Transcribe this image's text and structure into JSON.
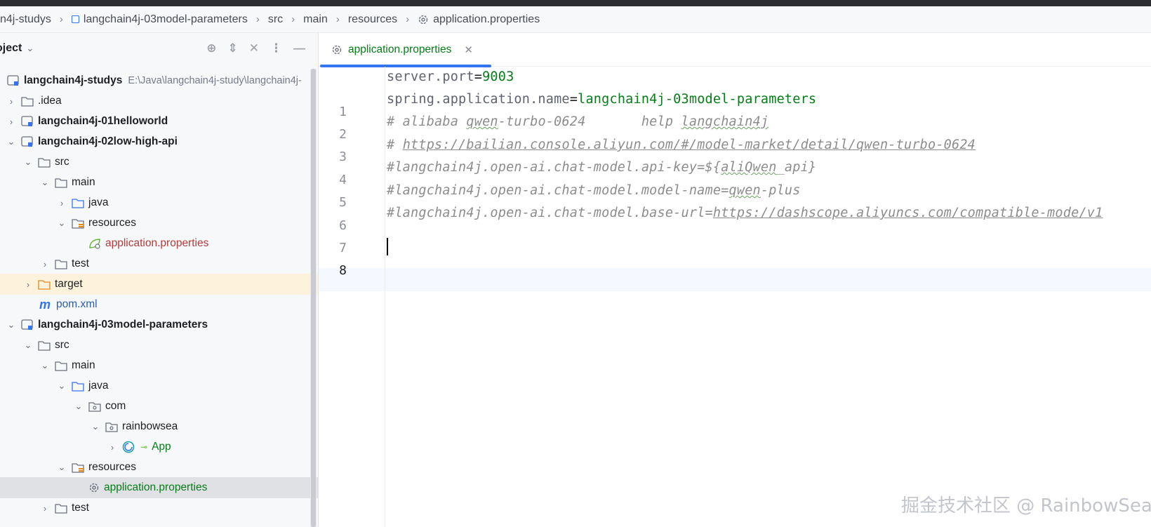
{
  "breadcrumb": {
    "items": [
      "n4j-studys",
      "langchain4j-03model-parameters",
      "src",
      "main",
      "resources",
      "application.properties"
    ]
  },
  "panel": {
    "title": "oject",
    "tree": [
      {
        "label": "langchain4j-studys",
        "hint": "E:\\Java\\langchain4j-study\\langchain4j-"
      },
      {
        "label": ".idea"
      },
      {
        "label": "langchain4j-01helloworld"
      },
      {
        "label": "langchain4j-02low-high-api"
      },
      {
        "label": "src"
      },
      {
        "label": "main"
      },
      {
        "label": "java"
      },
      {
        "label": "resources"
      },
      {
        "label": "application.properties"
      },
      {
        "label": "test"
      },
      {
        "label": "target"
      },
      {
        "label": "pom.xml"
      },
      {
        "label": "langchain4j-03model-parameters"
      },
      {
        "label": "src"
      },
      {
        "label": "main"
      },
      {
        "label": "java"
      },
      {
        "label": "com"
      },
      {
        "label": "rainbowsea"
      },
      {
        "label": "App"
      },
      {
        "label": "resources"
      },
      {
        "label": "application.properties"
      },
      {
        "label": "test"
      }
    ]
  },
  "editor": {
    "tab_label": "application.properties",
    "line_numbers": [
      "1",
      "2",
      "3",
      "4",
      "5",
      "6",
      "7",
      "8"
    ],
    "lines": {
      "l1_key": "server.port",
      "l1_eq": "=",
      "l1_val": "9003",
      "l2_key": "spring.application.name",
      "l2_eq": "=",
      "l2_val": "langchain4j-03model-parameters",
      "l3_a": "# alibaba ",
      "l3_b": "qwen",
      "l3_c": "-turbo-0624       help ",
      "l3_d": "langchain4j",
      "l4_a": "# ",
      "l4_link": "https://bailian.console.aliyun.com/#/model-market/detail/qwen-turbo-0624",
      "l5_a": "#langchain4j.open-ai.chat-model.api-key=${",
      "l5_b": "aliQwen",
      "l5_c": "_api}",
      "l6_a": "#langchain4j.open-ai.chat-model.model-name=",
      "l6_b": "qwen",
      "l6_c": "-plus",
      "l7_a": "#langchain4j.open-ai.chat-model.base-url=",
      "l7_link": "https://dashscope.aliyuncs.com/compatible-mode/v1"
    }
  },
  "watermark": "掘金技术社区 @ RainbowSea",
  "colors": {
    "accent": "#3574f0",
    "value_green": "#067d17",
    "comment_gray": "#8c8c8c"
  }
}
